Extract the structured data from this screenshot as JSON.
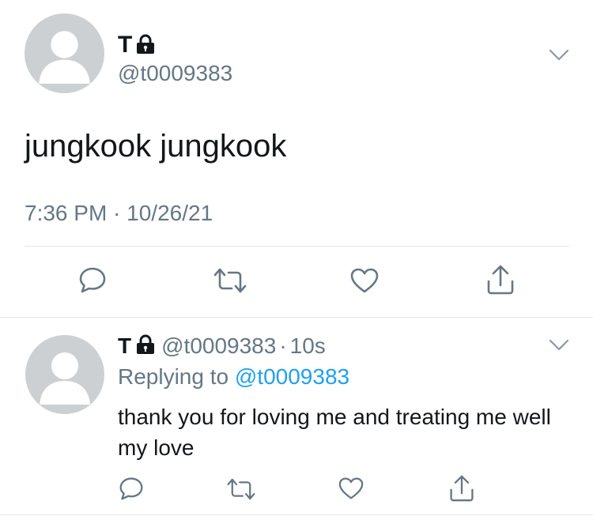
{
  "main_tweet": {
    "author_name": "T",
    "author_handle": "@t0009383",
    "text": "jungkook jungkook",
    "timestamp": "7:36 PM · 10/26/21",
    "protected_icon": "lock-icon",
    "menu_icon": "chevron-down-icon",
    "actions": [
      "reply-icon",
      "retweet-icon",
      "like-icon",
      "share-icon"
    ]
  },
  "reply_tweet": {
    "author_name": "T",
    "author_handle": "@t0009383",
    "separator": "·",
    "time_ago": "10s",
    "replying_prefix": "Replying to",
    "replying_handle": "@t0009383",
    "text": "thank you for loving me and treating me well my love",
    "protected_icon": "lock-icon",
    "menu_icon": "chevron-down-icon",
    "actions": [
      "reply-icon",
      "retweet-icon",
      "like-icon",
      "share-icon"
    ]
  },
  "colors": {
    "text": "#14171a",
    "secondary": "#657786",
    "link": "#1da1f2",
    "divider": "#e1e6ea",
    "avatar_bg": "#cdd0d3"
  }
}
